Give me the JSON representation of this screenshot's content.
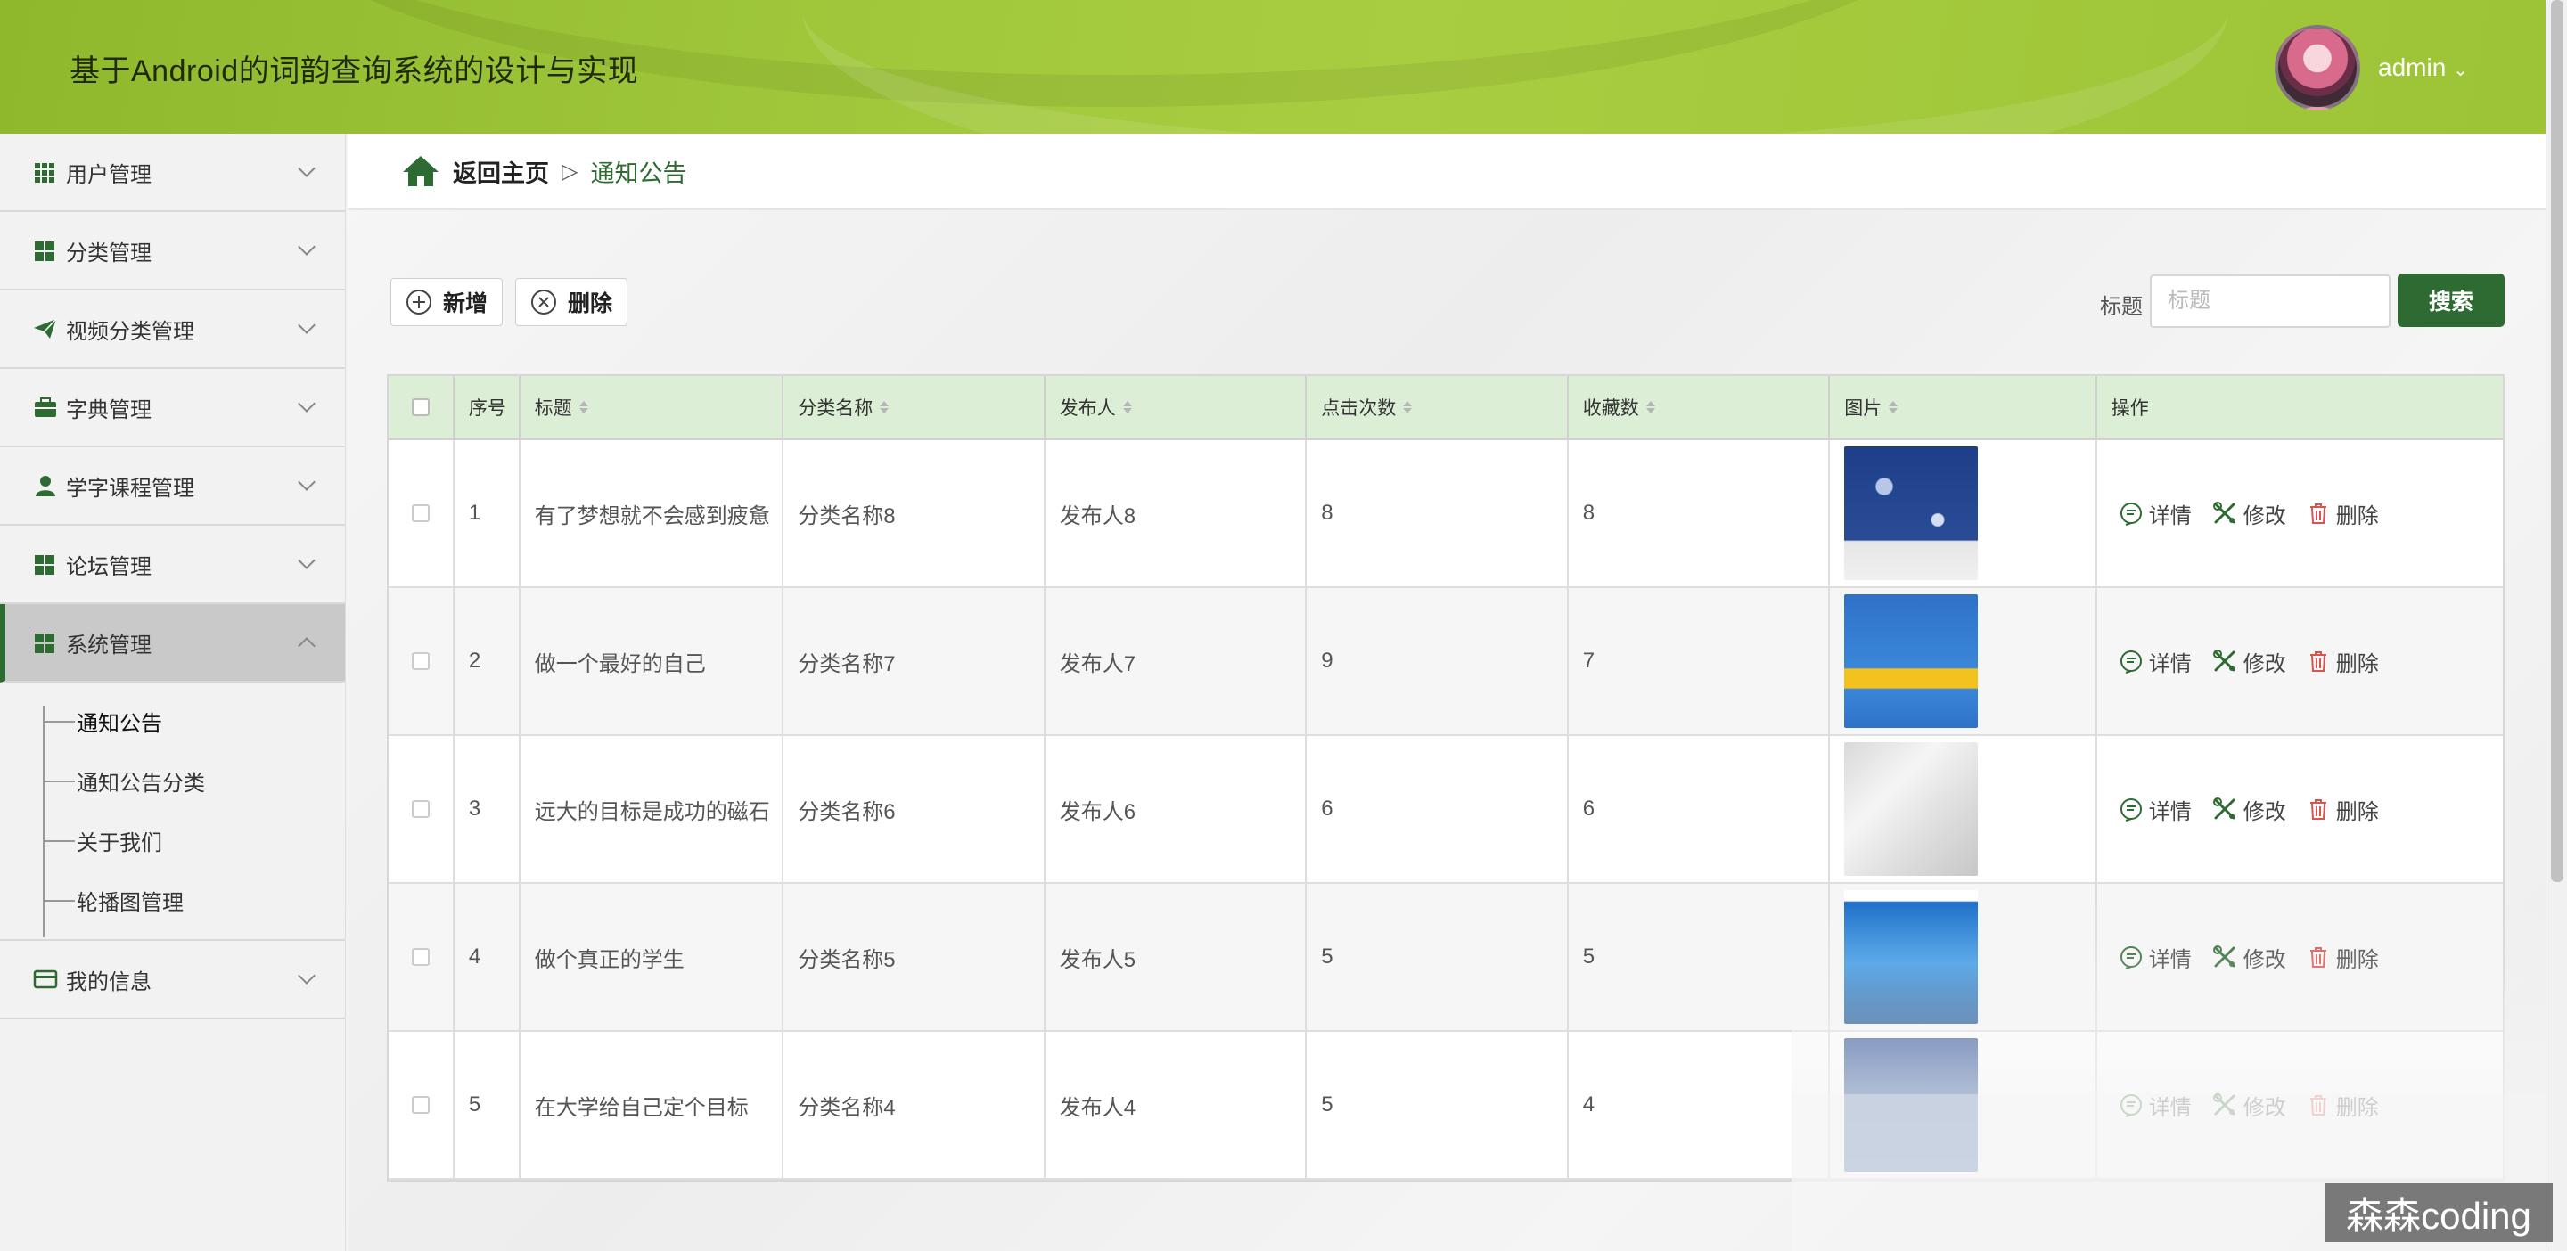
{
  "header": {
    "title": "基于Android的词韵查询系统的设计与实现",
    "user": "admin"
  },
  "sidebar": {
    "items": [
      {
        "label": "用户管理",
        "icon": "grid-icon"
      },
      {
        "label": "分类管理",
        "icon": "grid-icon"
      },
      {
        "label": "视频分类管理",
        "icon": "paper-plane-icon"
      },
      {
        "label": "字典管理",
        "icon": "briefcase-icon"
      },
      {
        "label": "学字课程管理",
        "icon": "user-icon"
      },
      {
        "label": "论坛管理",
        "icon": "grid-icon"
      },
      {
        "label": "系统管理",
        "icon": "grid-icon",
        "expanded": true
      }
    ],
    "submenu": [
      "通知公告",
      "通知公告分类",
      "关于我们",
      "轮播图管理"
    ],
    "last_item": {
      "label": "我的信息",
      "icon": "card-icon"
    }
  },
  "breadcrumb": {
    "home": "返回主页",
    "separator": "▷",
    "current": "通知公告"
  },
  "toolbar": {
    "add_label": "新增",
    "delete_label": "删除"
  },
  "search": {
    "label": "标题",
    "placeholder": "标题",
    "button": "搜索"
  },
  "table": {
    "headers": [
      "序号",
      "标题",
      "分类名称",
      "发布人",
      "点击次数",
      "收藏数",
      "图片",
      "操作"
    ],
    "rows": [
      {
        "no": "1",
        "title": "有了梦想就不会感到疲惫",
        "category": "分类名称8",
        "publisher": "发布人8",
        "clicks": "8",
        "favorites": "8",
        "cover": "book-cover-blue-pattern"
      },
      {
        "no": "2",
        "title": "做一个最好的自己",
        "category": "分类名称7",
        "publisher": "发布人7",
        "clicks": "9",
        "favorites": "7",
        "cover": "book-cover-world-history"
      },
      {
        "no": "3",
        "title": "远大的目标是成功的磁石",
        "category": "分类名称6",
        "publisher": "发布人6",
        "clicks": "6",
        "favorites": "6",
        "cover": "book-cover-white"
      },
      {
        "no": "4",
        "title": "做个真正的学生",
        "category": "分类名称5",
        "publisher": "发布人5",
        "clicks": "5",
        "favorites": "5",
        "cover": "book-cover-blue-whale"
      },
      {
        "no": "5",
        "title": "在大学给自己定个目标",
        "category": "分类名称4",
        "publisher": "发布人4",
        "clicks": "5",
        "favorites": "4",
        "cover": "book-cover-blue"
      }
    ],
    "actions": {
      "detail": "详情",
      "edit": "修改",
      "delete": "删除"
    }
  },
  "colors": {
    "primary": "#2e6b33",
    "header": "#9cc436",
    "table_header": "#dcefd6"
  },
  "watermark": "森森coding"
}
